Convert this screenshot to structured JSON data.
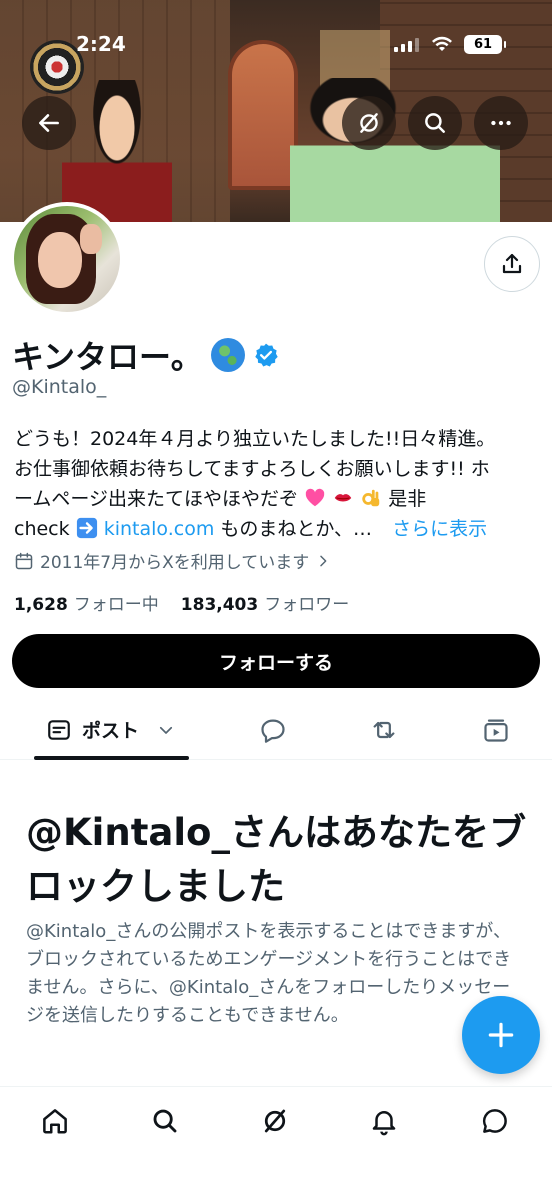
{
  "status_bar": {
    "time": "2:24",
    "battery": "61"
  },
  "banner": {
    "icons": [
      "back-arrow-icon",
      "grok-icon",
      "search-icon",
      "more-icon"
    ]
  },
  "profile": {
    "display_name": "キンタロー。",
    "handle": "@Kintalo_",
    "bio": {
      "line1": "どうも！2024年４月より独立いたしました!!日々精進。",
      "line2": "お仕事御依頼お待ちしてますよろしくお願いします!! ホ",
      "line3": "ームページ出来たてほやほやだぞ",
      "line3_tail": "是非",
      "line4_start": "check",
      "link": "kintalo.com",
      "line4_mid": " ものまねとか、…",
      "more": "さらに表示"
    },
    "joined": "2011年7月からXを利用しています",
    "following_count": "1,628",
    "following_label": "フォロー中",
    "followers_count": "183,403",
    "followers_label": "フォロワー",
    "follow_button": "フォローする"
  },
  "tabs": {
    "posts_label": "ポスト"
  },
  "blocked": {
    "title": "@Kintalo_さんはあなたをブロックしました",
    "description": "@Kintalo_さんの公開ポストを表示することはできますが、ブロックされているためエンゲージメントを行うことはできません。さらに、@Kintalo_さんをフォローしたりメッセージを送信したりすることもできません。"
  },
  "colors": {
    "accent": "#1d9bf0",
    "text": "#0f1419",
    "secondary": "#536471"
  }
}
